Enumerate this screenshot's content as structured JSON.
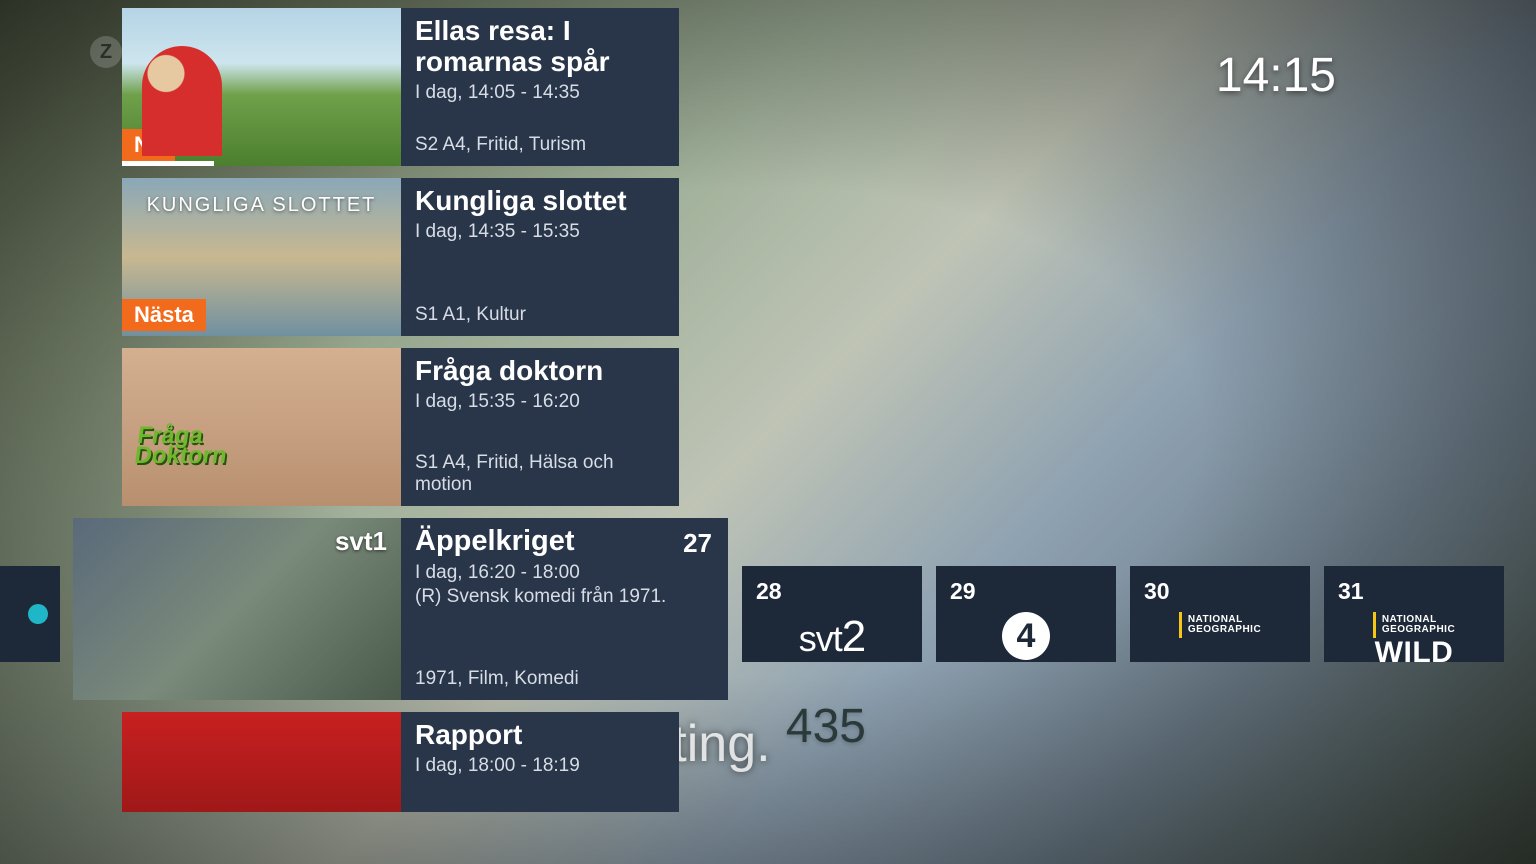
{
  "clock": "14:15",
  "house_number": "435",
  "subtitle_text": "ne ting.",
  "programs": [
    {
      "title": "Ellas resa: I romarnas spår",
      "time": "I dag, 14:05 - 14:35",
      "desc": "",
      "tags": "S2 A4, Fritid, Turism",
      "badge": "Nu",
      "progress": 33,
      "thumb_text": ""
    },
    {
      "title": "Kungliga slottet",
      "time": "I dag, 14:35 - 15:35",
      "desc": "",
      "tags": "S1 A1, Kultur",
      "badge": "Nästa",
      "progress": 0,
      "thumb_text": "KUNGLIGA SLOTTET"
    },
    {
      "title": "Fråga doktorn",
      "time": "I dag, 15:35 - 16:20",
      "desc": "",
      "tags": "S1 A4, Fritid, Hälsa och motion",
      "badge": "",
      "progress": 0,
      "thumb_text": "Fråga\nDoktorn"
    },
    {
      "title": "Äppelkriget",
      "time": "I dag, 16:20 - 18:00",
      "desc": "(R) Svensk komedi från 1971.",
      "tags": "1971, Film, Komedi",
      "badge": "",
      "progress": 0,
      "channel_no": "27",
      "channel_logo": "svt1",
      "selected": true
    },
    {
      "title": "Rapport",
      "time": "I dag, 18:00 - 18:19",
      "desc": "",
      "tags": "",
      "badge": "",
      "progress": 0
    }
  ],
  "channels": [
    {
      "no": "28",
      "name": "svt2"
    },
    {
      "no": "29",
      "name": "tv4"
    },
    {
      "no": "30",
      "name": "natgeo"
    },
    {
      "no": "31",
      "name": "natgeo-wild"
    }
  ],
  "logos": {
    "svt1": "svt1",
    "svt2_a": "s",
    "svt2_b": "v",
    "svt2_c": "t",
    "svt2_d": "2",
    "tv4": "4",
    "ng_top": "NATIONAL",
    "ng_bot": "GEOGRAPHIC",
    "wild": "WILD"
  }
}
